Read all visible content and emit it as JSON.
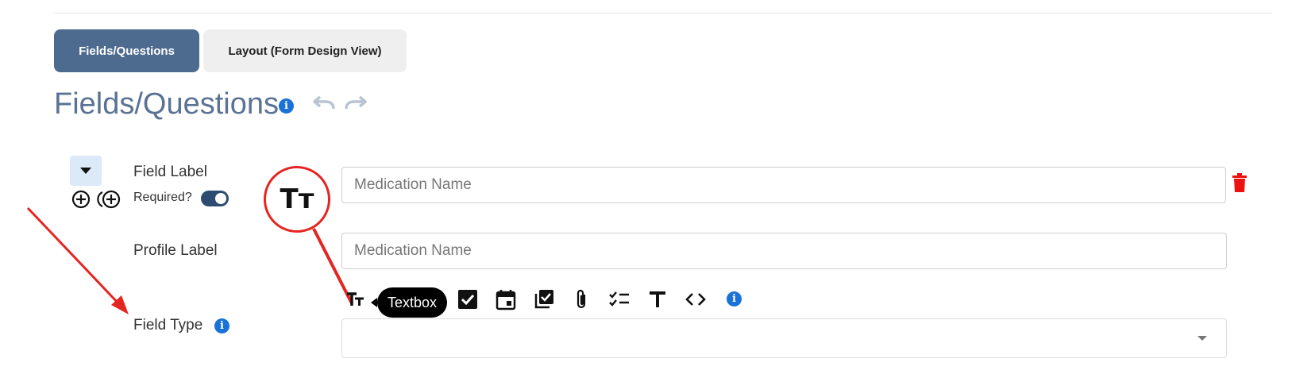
{
  "tabs": [
    {
      "label": "Fields/Questions",
      "active": true
    },
    {
      "label": "Layout (Form Design View)",
      "active": false
    }
  ],
  "title": "Fields/Questions",
  "field": {
    "label_title": "Field Label",
    "required_label": "Required?",
    "required_on": true,
    "field_label_value": "Medication Name",
    "profile_label_title": "Profile Label",
    "profile_label_value": "Medication Name",
    "field_type_title": "Field Type",
    "field_type_value": ""
  },
  "callout_icon_text": "Tт",
  "toolbar": {
    "tooltip": "Textbox",
    "icons": [
      "textbox-icon",
      "checkbox-icon",
      "calendar-icon",
      "multi-checkbox-icon",
      "attachment-icon",
      "checklist-icon",
      "text-icon",
      "code-icon",
      "info-icon"
    ]
  },
  "colors": {
    "accent": "#4d6a8f",
    "info": "#1a72d9",
    "danger": "#e52521",
    "toggle": "#2d4c72"
  }
}
